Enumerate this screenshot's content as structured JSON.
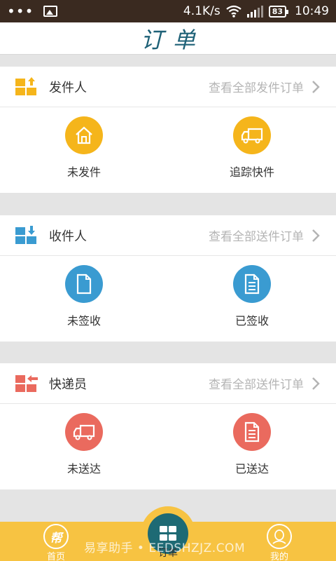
{
  "status_bar": {
    "dots": "•••",
    "speed": "4.1K/s",
    "battery": "83",
    "time": "10:49"
  },
  "header": {
    "title": "订单"
  },
  "sections": [
    {
      "title": "发件人",
      "link": "查看全部发件订单",
      "accent": "#f5b51b",
      "items": [
        {
          "label": "未发件",
          "icon": "house-icon"
        },
        {
          "label": "追踪快件",
          "icon": "truck-icon"
        }
      ]
    },
    {
      "title": "收件人",
      "link": "查看全部送件订单",
      "accent": "#3a9bd1",
      "items": [
        {
          "label": "未签收",
          "icon": "blank-document-icon"
        },
        {
          "label": "已签收",
          "icon": "lined-document-icon"
        }
      ]
    },
    {
      "title": "快递员",
      "link": "查看全部送件订单",
      "accent": "#ea6a5e",
      "items": [
        {
          "label": "未送达",
          "icon": "truck-icon"
        },
        {
          "label": "已送达",
          "icon": "lined-document-icon"
        }
      ]
    }
  ],
  "bottom_nav": {
    "home": {
      "label": "首页",
      "icon_text": "帮"
    },
    "orders": {
      "label": "订单"
    },
    "mine": {
      "label": "我的"
    }
  },
  "watermark": "易享助手 • EEDSHZJZ.COM"
}
